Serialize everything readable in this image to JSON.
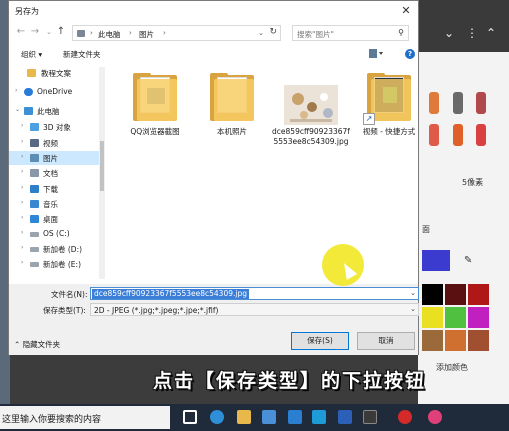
{
  "dialog": {
    "title": "另存为",
    "close_label": "✕"
  },
  "address": {
    "crumbs": [
      "此电脑",
      "图片"
    ],
    "refresh_label": "↻"
  },
  "search": {
    "placeholder": "搜索\"图片\""
  },
  "toolbar": {
    "organize_label": "组织 ▾",
    "new_folder_label": "新建文件夹"
  },
  "nav": {
    "items": [
      {
        "label": "教程文案",
        "icon": "folder-icon"
      },
      {
        "label": "OneDrive",
        "icon": "cloud-icon"
      },
      {
        "label": "此电脑",
        "icon": "computer-icon"
      },
      {
        "label": "3D 对象",
        "icon": "3d-objects-icon"
      },
      {
        "label": "视频",
        "icon": "video-icon"
      },
      {
        "label": "图片",
        "icon": "pictures-icon",
        "selected": true
      },
      {
        "label": "文档",
        "icon": "documents-icon"
      },
      {
        "label": "下载",
        "icon": "download-icon"
      },
      {
        "label": "音乐",
        "icon": "music-icon"
      },
      {
        "label": "桌面",
        "icon": "desktop-icon"
      },
      {
        "label": "OS (C:)",
        "icon": "drive-icon"
      },
      {
        "label": "新加卷 (D:)",
        "icon": "drive-icon"
      },
      {
        "label": "新加卷 (E:)",
        "icon": "drive-icon"
      }
    ]
  },
  "files": [
    {
      "label": "QQ浏览器截图",
      "icon": "folder-icon"
    },
    {
      "label": "本机照片",
      "icon": "folder-icon"
    },
    {
      "label": "dce859cff90923367f5553ee8c54309.jpg",
      "icon": "image-thumbnail"
    },
    {
      "label": "视频 - 快捷方式",
      "icon": "shortcut-folder-icon"
    }
  ],
  "filename": {
    "label": "文件名(N):",
    "value": "dce859cff90923367f5553ee8c54309.jpg"
  },
  "filetype": {
    "label": "保存类型(T):",
    "value": "2D - JPEG (*.jpg;*.jpeg;*.jpe;*.jfif)"
  },
  "buttons": {
    "hide_folders": "隐藏文件夹",
    "save": "保存(S)",
    "cancel": "取消"
  },
  "background_app": {
    "size_text": "5像素",
    "add_color_text": "添加颜色",
    "partial_label": "面"
  },
  "subtitle": "点击【保存类型】的下拉按钮",
  "taskbar": {
    "search_text": "这里输入你要搜索的内容"
  }
}
